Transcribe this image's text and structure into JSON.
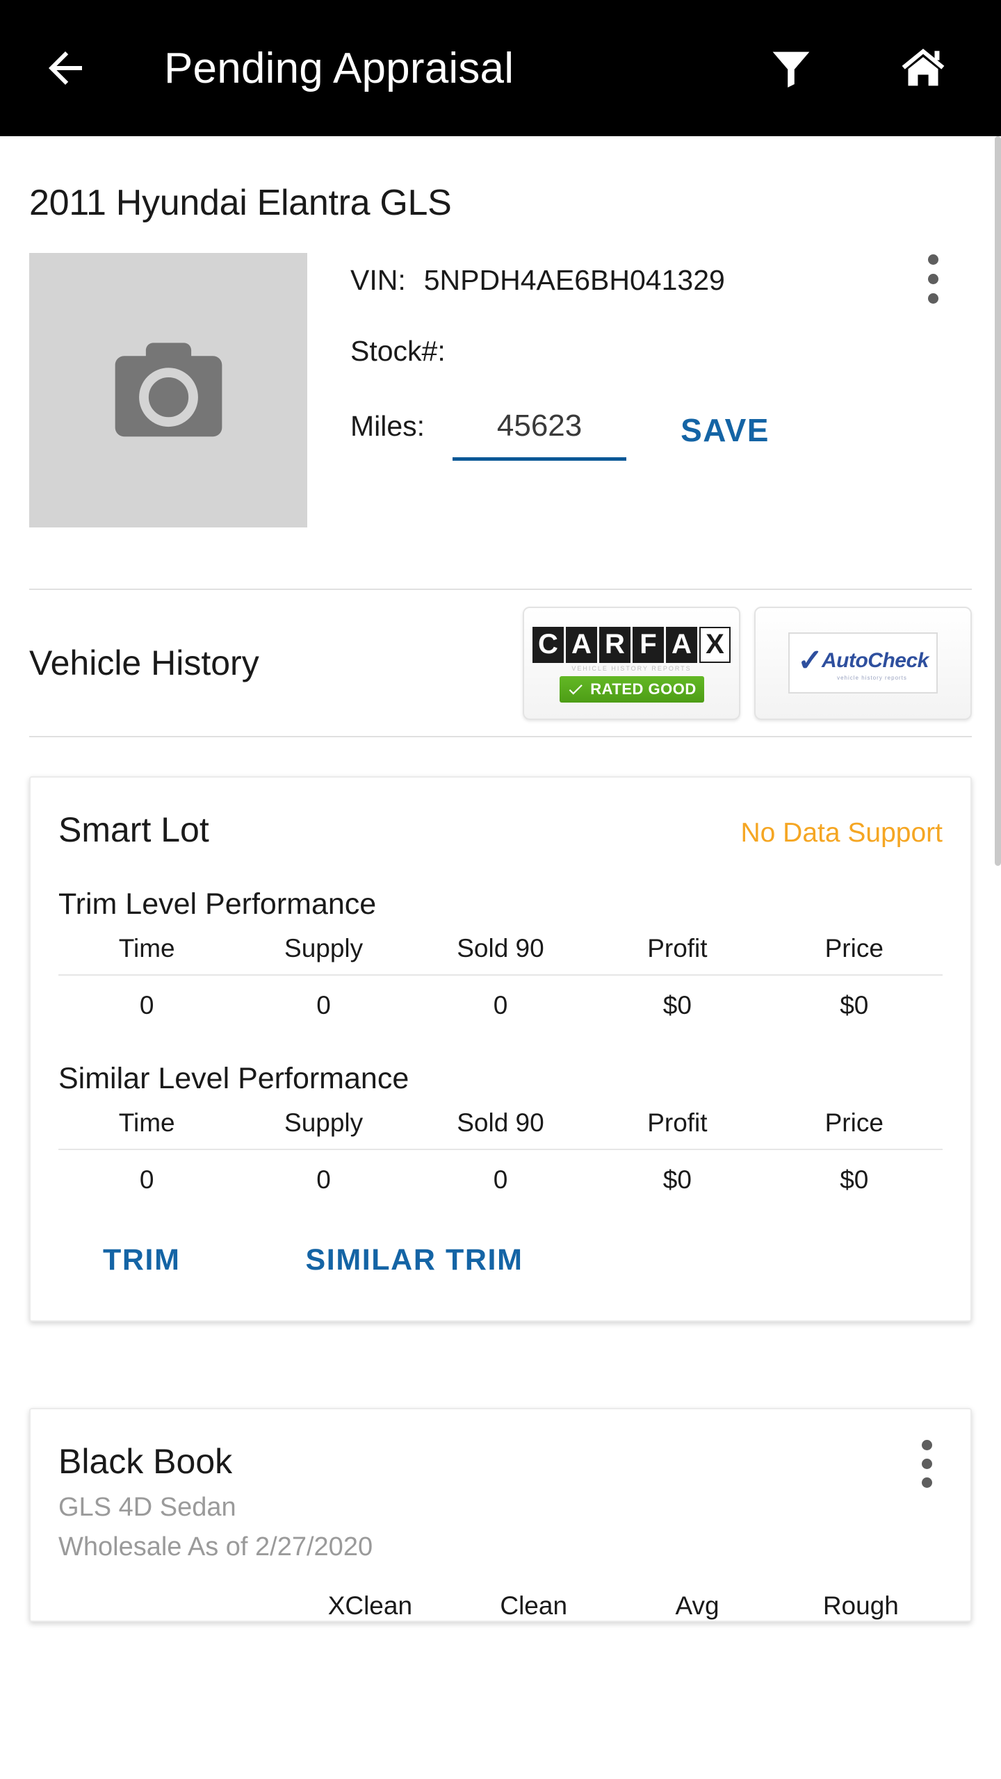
{
  "appbar": {
    "title": "Pending Appraisal",
    "back_icon": "arrow-left-icon",
    "filter_icon": "filter-funnel-icon",
    "home_icon": "home-icon"
  },
  "vehicle": {
    "title": "2011 Hyundai Elantra GLS",
    "photo_placeholder_icon": "camera-icon",
    "vin_label": "VIN:",
    "vin_value": "5NPDH4AE6BH041329",
    "stock_label": "Stock#:",
    "stock_value": "",
    "miles_label": "Miles:",
    "miles_value": "45623",
    "miles_placeholder": "Miles",
    "save_label": "SAVE",
    "overflow_icon": "more-vertical-icon"
  },
  "vehicle_history": {
    "label": "Vehicle History",
    "carfax": {
      "letters": [
        "C",
        "A",
        "R",
        "F",
        "A",
        "X"
      ],
      "tagline": "VEHICLE HISTORY REPORTS",
      "badge_label": "RATED GOOD",
      "badge_icon": "check-icon",
      "badge_color": "#55a81c"
    },
    "autocheck": {
      "check_icon": "check-icon",
      "name": "AutoCheck",
      "tagline": "vehicle history reports",
      "brand_color": "#2e4f9e"
    }
  },
  "smart_lot": {
    "title": "Smart Lot",
    "status": "No Data Support",
    "status_color": "#f5a623",
    "trim_section_title": "Trim Level Performance",
    "similar_section_title": "Similar Level Performance",
    "columns": [
      "Time",
      "Supply",
      "Sold 90",
      "Profit",
      "Price"
    ],
    "trim_values": [
      "0",
      "0",
      "0",
      "$0",
      "$0"
    ],
    "similar_values": [
      "0",
      "0",
      "0",
      "$0",
      "$0"
    ],
    "trim_button": "TRIM",
    "similar_trim_button": "SIMILAR TRIM",
    "link_color": "#1464a5"
  },
  "black_book": {
    "title": "Black Book",
    "subtitle": "GLS 4D Sedan",
    "as_of": "Wholesale As of 2/27/2020",
    "overflow_icon": "more-vertical-icon",
    "columns": [
      "XClean",
      "Clean",
      "Avg",
      "Rough"
    ]
  }
}
